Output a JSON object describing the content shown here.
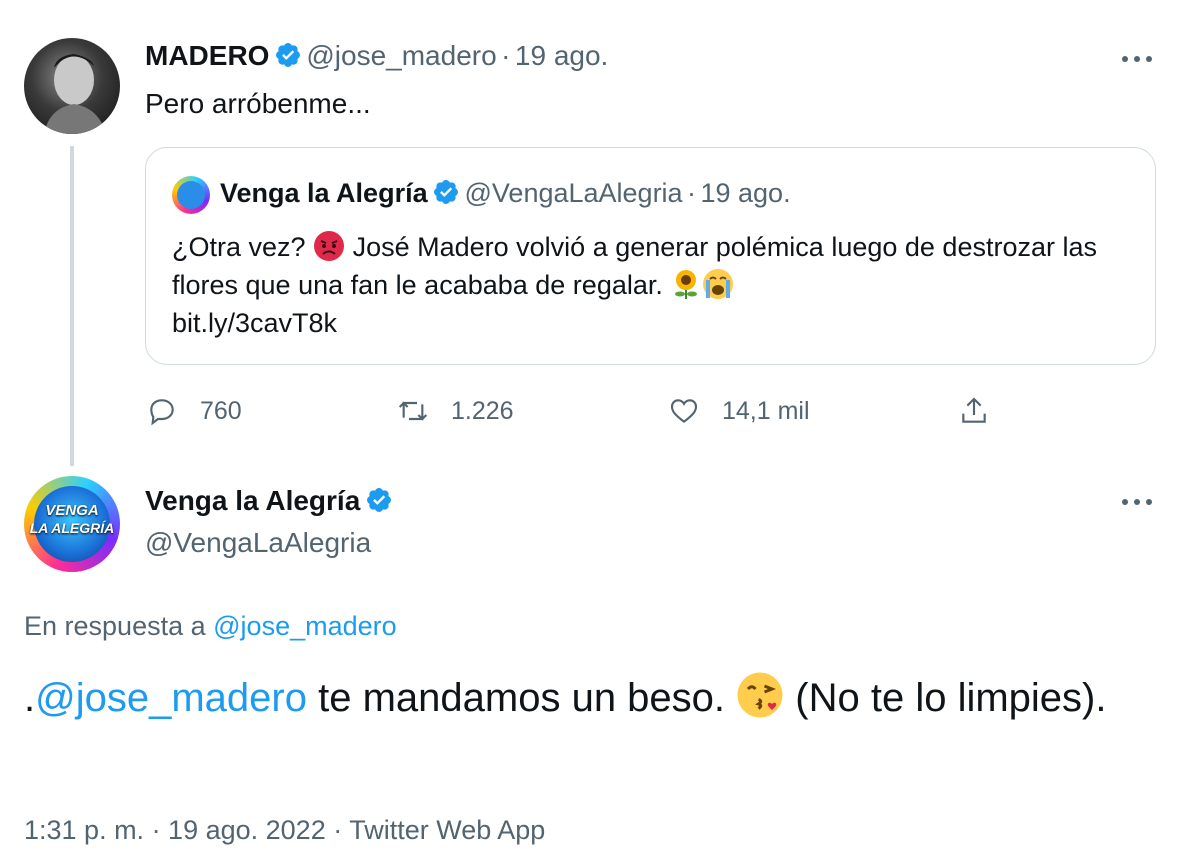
{
  "tweet1": {
    "name": "MADERO",
    "handle": "@jose_madero",
    "sep": "·",
    "date": "19 ago.",
    "text": "Pero arróbenme...",
    "quote": {
      "name": "Venga la Alegría",
      "handle": "@VengaLaAlegria",
      "sep": "·",
      "date": "19 ago.",
      "text_part1": "¿Otra vez?",
      "text_part2": "José Madero volvió a generar polémica luego de destrozar las flores que una fan le acababa de regalar.",
      "link": "bit.ly/3cavT8k"
    },
    "actions": {
      "replies": "760",
      "retweets": "1.226",
      "likes": "14,1 mil"
    }
  },
  "tweet2": {
    "name": "Venga la Alegría",
    "handle": "@VengaLaAlegria",
    "avatar_line1": "VENGA",
    "avatar_line2": "LA ALEGRÍA",
    "reply_prefix": "En respuesta a",
    "reply_handle": "@jose_madero",
    "text_dot": ".",
    "text_mention": "@jose_madero",
    "text_part1": "te mandamos un beso.",
    "text_part2": "(No te lo limpies).",
    "timestamp": "1:31 p. m. · 19 ago. 2022 · Twitter Web App"
  },
  "colors": {
    "text": "#0f1419",
    "secondary": "#536471",
    "accent": "#1d9bf0",
    "border": "#cfd9de"
  },
  "icons": [
    "verified-badge-icon",
    "more-icon",
    "reply-icon",
    "retweet-icon",
    "like-icon",
    "share-icon",
    "angry-face-emoji",
    "sunflower-emoji",
    "crying-face-emoji",
    "kiss-face-emoji"
  ]
}
